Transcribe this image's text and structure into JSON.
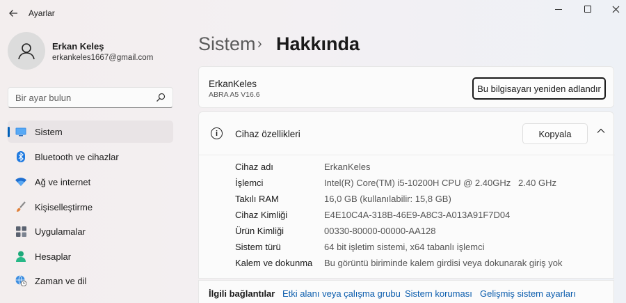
{
  "window": {
    "title": "Ayarlar"
  },
  "profile": {
    "name": "Erkan Keleş",
    "email": "erkankeles1667@gmail.com"
  },
  "search": {
    "placeholder": "Bir ayar bulun"
  },
  "sidebar": {
    "items": [
      {
        "label": "Sistem",
        "icon": "monitor-icon",
        "active": true
      },
      {
        "label": "Bluetooth ve cihazlar",
        "icon": "bluetooth-icon"
      },
      {
        "label": "Ağ ve internet",
        "icon": "wifi-icon"
      },
      {
        "label": "Kişiselleştirme",
        "icon": "brush-icon"
      },
      {
        "label": "Uygulamalar",
        "icon": "apps-icon"
      },
      {
        "label": "Hesaplar",
        "icon": "person-icon"
      },
      {
        "label": "Zaman ve dil",
        "icon": "globe-clock-icon"
      }
    ]
  },
  "breadcrumb": {
    "parent": "Sistem",
    "separator": "›",
    "current": "Hakkında"
  },
  "device": {
    "name": "ErkanKeles",
    "model": "ABRA A5 V16.6",
    "rename_label": "Bu bilgisayarı yeniden adlandır"
  },
  "specs": {
    "title": "Cihaz özellikleri",
    "copy_label": "Kopyala",
    "rows": [
      {
        "label": "Cihaz adı",
        "value": "ErkanKeles"
      },
      {
        "label": "İşlemci",
        "value": "Intel(R) Core(TM) i5-10200H CPU @ 2.40GHz   2.40 GHz"
      },
      {
        "label": "Takılı RAM",
        "value": "16,0 GB (kullanılabilir: 15,8 GB)"
      },
      {
        "label": "Cihaz Kimliği",
        "value": "E4E10C4A-318B-46E9-A8C3-A013A91F7D04"
      },
      {
        "label": "Ürün Kimliği",
        "value": "00330-80000-00000-AA128"
      },
      {
        "label": "Sistem türü",
        "value": "64 bit işletim sistemi, x64 tabanlı işlemci"
      },
      {
        "label": "Kalem ve dokunma",
        "value": "Bu görüntü biriminde kalem girdisi veya dokunarak giriş yok"
      }
    ]
  },
  "related": {
    "title": "İlgili bağlantılar",
    "links": [
      "Etki alanı veya çalışma grubu",
      "Sistem koruması",
      "Gelişmiş sistem ayarları"
    ]
  },
  "colors": {
    "accent": "#005fb8",
    "link": "#0a5cad"
  }
}
